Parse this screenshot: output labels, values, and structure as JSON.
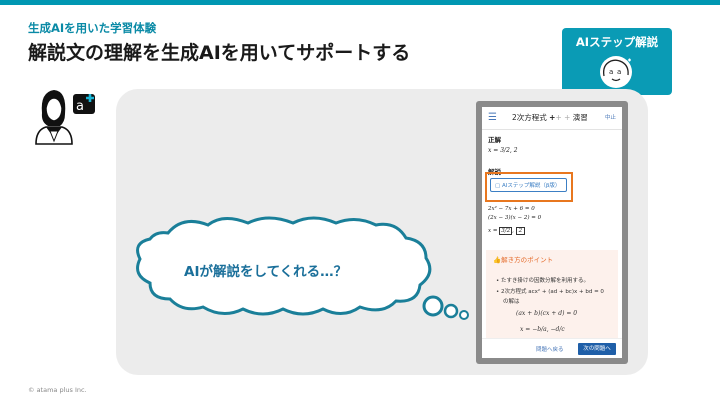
{
  "eyebrow": "生成AIを用いた学習体験",
  "title": "解説文の理解を生成AIを用いてサポートする",
  "badge": {
    "label": "AIステップ解説"
  },
  "phone": {
    "title_prefix": "2次方程式 ",
    "title_plus": "+",
    "title_dots": "+ +",
    "title_suffix": " 演習",
    "header_right": "中止",
    "correct_label": "正解",
    "answer": "x = 3/2, 2",
    "explanation_label": "解説",
    "ai_button": "AIステップ解説（β版）",
    "eq1": "2x² − 7x + 6 = 0",
    "eq2": "(2x − 3)(x − 2) = 0",
    "eq3_prefix": "x = ",
    "eq3_frac": "3/2",
    "eq3_val": "2",
    "solution": {
      "title": "解き方のポイント",
      "bullet1": "たすき掛けの因数分解を利用する。",
      "bullet2": "2次方程式 acx² + (ad + bc)x + bd = 0",
      "bullet2b": "の解は",
      "math1": "(ax + b)(cx + d) = 0",
      "math2": "x = −b/a, −d/c"
    },
    "prev_button": "問題へ戻る",
    "next_button": "次の問題へ"
  },
  "cloud_text": "AIが解説をしてくれる…？",
  "footer": "© atama plus Inc.",
  "colors": {
    "accent": "#0a9bb5",
    "highlight": "#e8771f",
    "cloud_stroke": "#1a7f99",
    "text_blue": "#1a6f9a"
  }
}
